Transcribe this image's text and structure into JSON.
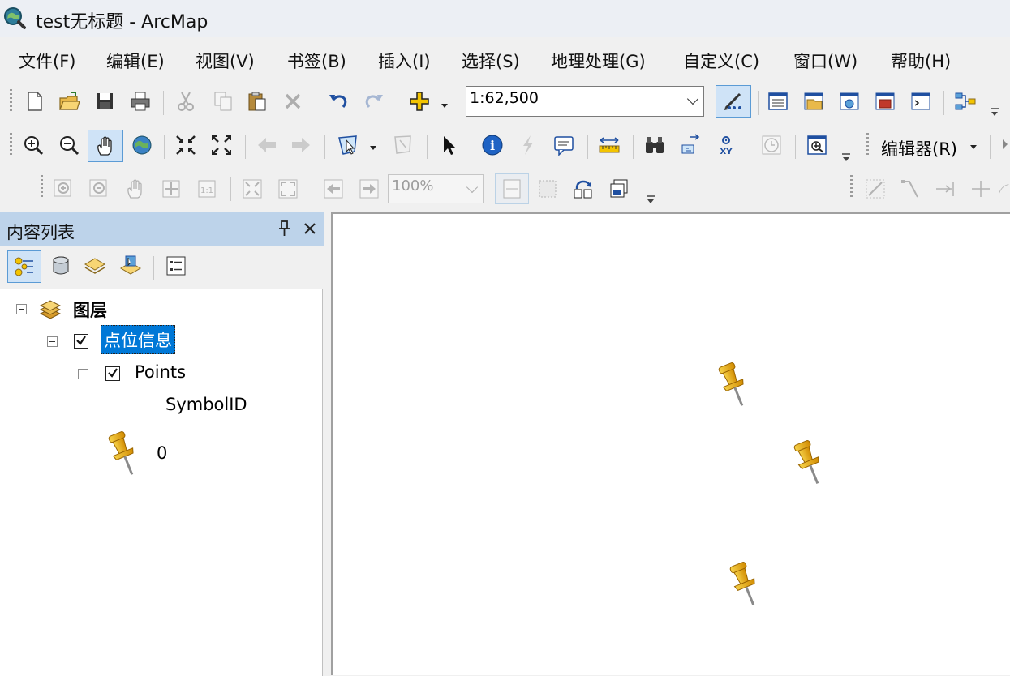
{
  "window": {
    "title": "test无标题 - ArcMap",
    "icon": "arcmap-globe-icon"
  },
  "menu": [
    "文件(F)",
    "编辑(E)",
    "视图(V)",
    "书签(B)",
    "插入(I)",
    "选择(S)",
    "地理处理(G)",
    "自定义(C)",
    "窗口(W)",
    "帮助(H)"
  ],
  "standard_toolbar": {
    "scale": "1:62,500",
    "icons": [
      "new-document-icon",
      "open-folder-icon",
      "save-icon",
      "print-icon",
      "cut-icon",
      "copy-icon",
      "paste-icon",
      "delete-icon",
      "undo-icon",
      "redo-icon",
      "add-data-icon",
      "editor-toolbar-icon",
      "table-of-contents-icon",
      "catalog-icon",
      "search-icon",
      "arctoolbox-icon",
      "python-window-icon",
      "model-builder-icon"
    ]
  },
  "tools_toolbar": {
    "editor_label": "编辑器(R)",
    "icons": [
      "zoom-in-icon",
      "zoom-out-icon",
      "pan-hand-icon",
      "full-extent-globe-icon",
      "fixed-zoom-in-icon",
      "fixed-zoom-out-icon",
      "back-arrow-icon",
      "forward-arrow-icon",
      "select-features-icon",
      "clear-selection-icon",
      "select-elements-icon",
      "identify-icon",
      "hyperlink-icon",
      "html-popup-icon",
      "measure-icon",
      "find-binoculars-icon",
      "find-route-icon",
      "go-to-xy-icon",
      "time-slider-icon",
      "magnifier-window-icon"
    ]
  },
  "layout_toolbar": {
    "zoom_percent": "100%"
  },
  "toc": {
    "title": "内容列表",
    "pin_label": "ᵒ",
    "close_label": "✕",
    "root": "图层",
    "group_layer": "点位信息",
    "layer": "Points",
    "field": "SymbolID",
    "legend_value": "0"
  },
  "colors": {
    "toc_header": "#bdd3ea",
    "selection": "#0078d7",
    "pin_yellow": "#f5b400"
  }
}
